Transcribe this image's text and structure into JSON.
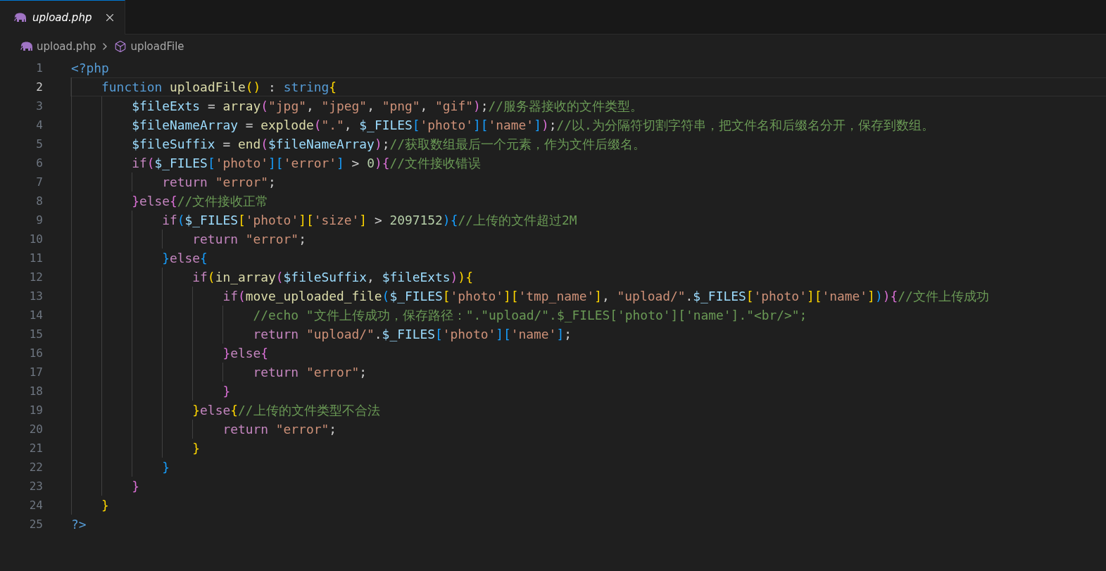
{
  "tabs": [
    {
      "label": "upload.php",
      "selected": true,
      "preview": true
    }
  ],
  "breadcrumb": {
    "file": "upload.php",
    "symbol": "uploadFile"
  },
  "lines": [
    {
      "number": "1",
      "selected": false,
      "tokens": [
        {
          "kind": "kw",
          "text": "<?php"
        }
      ],
      "children": [
        {
          "number": "2",
          "selected": true,
          "tokens": [
            {
              "kind": "kw",
              "text": "function "
            },
            {
              "kind": "fn",
              "text": "uploadFile"
            },
            {
              "kind": "b1",
              "text": "()"
            },
            {
              "kind": "op",
              "text": " : "
            },
            {
              "kind": "kw",
              "text": "string"
            },
            {
              "kind": "b1",
              "text": "{"
            }
          ],
          "children": [
            {
              "number": "3",
              "selected": false,
              "tokens": [
                {
                  "kind": "var",
                  "text": "$fileExts"
                },
                {
                  "kind": "op",
                  "text": " = "
                },
                {
                  "kind": "fn",
                  "text": "array"
                },
                {
                  "kind": "b2",
                  "text": "("
                },
                {
                  "kind": "str",
                  "text": "\"jpg\""
                },
                {
                  "kind": "op",
                  "text": ", "
                },
                {
                  "kind": "str",
                  "text": "\"jpeg\""
                },
                {
                  "kind": "op",
                  "text": ", "
                },
                {
                  "kind": "str",
                  "text": "\"png\""
                },
                {
                  "kind": "op",
                  "text": ", "
                },
                {
                  "kind": "str",
                  "text": "\"gif\""
                },
                {
                  "kind": "b2",
                  "text": ")"
                },
                {
                  "kind": "op",
                  "text": ";"
                },
                {
                  "kind": "cmt",
                  "text": "//服务器接收的文件类型。"
                }
              ]
            },
            {
              "number": "4",
              "selected": false,
              "tokens": [
                {
                  "kind": "var",
                  "text": "$fileNameArray"
                },
                {
                  "kind": "op",
                  "text": " = "
                },
                {
                  "kind": "fn",
                  "text": "explode"
                },
                {
                  "kind": "b2",
                  "text": "("
                },
                {
                  "kind": "str",
                  "text": "\".\""
                },
                {
                  "kind": "op",
                  "text": ", "
                },
                {
                  "kind": "var",
                  "text": "$_FILES"
                },
                {
                  "kind": "b3",
                  "text": "["
                },
                {
                  "kind": "str",
                  "text": "'photo'"
                },
                {
                  "kind": "b3",
                  "text": "]["
                },
                {
                  "kind": "str",
                  "text": "'name'"
                },
                {
                  "kind": "b3",
                  "text": "]"
                },
                {
                  "kind": "b2",
                  "text": ")"
                },
                {
                  "kind": "op",
                  "text": ";"
                },
                {
                  "kind": "cmt",
                  "text": "//以.为分隔符切割字符串，把文件名和后缀名分开，保存到数组。"
                }
              ]
            },
            {
              "number": "5",
              "selected": false,
              "tokens": [
                {
                  "kind": "var",
                  "text": "$fileSuffix"
                },
                {
                  "kind": "op",
                  "text": " = "
                },
                {
                  "kind": "fn",
                  "text": "end"
                },
                {
                  "kind": "b2",
                  "text": "("
                },
                {
                  "kind": "var",
                  "text": "$fileNameArray"
                },
                {
                  "kind": "b2",
                  "text": ")"
                },
                {
                  "kind": "op",
                  "text": ";"
                },
                {
                  "kind": "cmt",
                  "text": "//获取数组最后一个元素，作为文件后缀名。"
                }
              ]
            },
            {
              "number": "6",
              "selected": false,
              "tokens": [
                {
                  "kind": "ctrl",
                  "text": "if"
                },
                {
                  "kind": "b2",
                  "text": "("
                },
                {
                  "kind": "var",
                  "text": "$_FILES"
                },
                {
                  "kind": "b3",
                  "text": "["
                },
                {
                  "kind": "str",
                  "text": "'photo'"
                },
                {
                  "kind": "b3",
                  "text": "]["
                },
                {
                  "kind": "str",
                  "text": "'error'"
                },
                {
                  "kind": "b3",
                  "text": "]"
                },
                {
                  "kind": "op",
                  "text": " > "
                },
                {
                  "kind": "num",
                  "text": "0"
                },
                {
                  "kind": "b2",
                  "text": "){"
                },
                {
                  "kind": "cmt",
                  "text": "//文件接收错误"
                }
              ],
              "children": [
                {
                  "number": "7",
                  "selected": false,
                  "tokens": [
                    {
                      "kind": "ctrl",
                      "text": "return "
                    },
                    {
                      "kind": "str",
                      "text": "\"error\""
                    },
                    {
                      "kind": "op",
                      "text": ";"
                    }
                  ]
                }
              ]
            },
            {
              "number": "8",
              "selected": false,
              "tokens": [
                {
                  "kind": "b2",
                  "text": "}"
                },
                {
                  "kind": "ctrl",
                  "text": "else"
                },
                {
                  "kind": "b2",
                  "text": "{"
                },
                {
                  "kind": "cmt",
                  "text": "//文件接收正常"
                }
              ],
              "children": [
                {
                  "number": "9",
                  "selected": false,
                  "tokens": [
                    {
                      "kind": "ctrl",
                      "text": "if"
                    },
                    {
                      "kind": "b3",
                      "text": "("
                    },
                    {
                      "kind": "var",
                      "text": "$_FILES"
                    },
                    {
                      "kind": "b1",
                      "text": "["
                    },
                    {
                      "kind": "str",
                      "text": "'photo'"
                    },
                    {
                      "kind": "b1",
                      "text": "]["
                    },
                    {
                      "kind": "str",
                      "text": "'size'"
                    },
                    {
                      "kind": "b1",
                      "text": "]"
                    },
                    {
                      "kind": "op",
                      "text": " > "
                    },
                    {
                      "kind": "num",
                      "text": "2097152"
                    },
                    {
                      "kind": "b3",
                      "text": "){"
                    },
                    {
                      "kind": "cmt",
                      "text": "//上传的文件超过2M"
                    }
                  ],
                  "children": [
                    {
                      "number": "10",
                      "selected": false,
                      "tokens": [
                        {
                          "kind": "ctrl",
                          "text": "return "
                        },
                        {
                          "kind": "str",
                          "text": "\"error\""
                        },
                        {
                          "kind": "op",
                          "text": ";"
                        }
                      ]
                    }
                  ]
                },
                {
                  "number": "11",
                  "selected": false,
                  "tokens": [
                    {
                      "kind": "b3",
                      "text": "}"
                    },
                    {
                      "kind": "ctrl",
                      "text": "else"
                    },
                    {
                      "kind": "b3",
                      "text": "{"
                    }
                  ],
                  "children": [
                    {
                      "number": "12",
                      "selected": false,
                      "tokens": [
                        {
                          "kind": "ctrl",
                          "text": "if"
                        },
                        {
                          "kind": "b1",
                          "text": "("
                        },
                        {
                          "kind": "fn",
                          "text": "in_array"
                        },
                        {
                          "kind": "b2",
                          "text": "("
                        },
                        {
                          "kind": "var",
                          "text": "$fileSuffix"
                        },
                        {
                          "kind": "op",
                          "text": ", "
                        },
                        {
                          "kind": "var",
                          "text": "$fileExts"
                        },
                        {
                          "kind": "b2",
                          "text": ")"
                        },
                        {
                          "kind": "b1",
                          "text": "){"
                        }
                      ],
                      "children": [
                        {
                          "number": "13",
                          "selected": false,
                          "tokens": [
                            {
                              "kind": "ctrl",
                              "text": "if"
                            },
                            {
                              "kind": "b2",
                              "text": "("
                            },
                            {
                              "kind": "fn",
                              "text": "move_uploaded_file"
                            },
                            {
                              "kind": "b3",
                              "text": "("
                            },
                            {
                              "kind": "var",
                              "text": "$_FILES"
                            },
                            {
                              "kind": "b1",
                              "text": "["
                            },
                            {
                              "kind": "str",
                              "text": "'photo'"
                            },
                            {
                              "kind": "b1",
                              "text": "]["
                            },
                            {
                              "kind": "str",
                              "text": "'tmp_name'"
                            },
                            {
                              "kind": "b1",
                              "text": "]"
                            },
                            {
                              "kind": "op",
                              "text": ", "
                            },
                            {
                              "kind": "str",
                              "text": "\"upload/\""
                            },
                            {
                              "kind": "op",
                              "text": "."
                            },
                            {
                              "kind": "var",
                              "text": "$_FILES"
                            },
                            {
                              "kind": "b1",
                              "text": "["
                            },
                            {
                              "kind": "str",
                              "text": "'photo'"
                            },
                            {
                              "kind": "b1",
                              "text": "]["
                            },
                            {
                              "kind": "str",
                              "text": "'name'"
                            },
                            {
                              "kind": "b1",
                              "text": "]"
                            },
                            {
                              "kind": "b3",
                              "text": ")"
                            },
                            {
                              "kind": "b2",
                              "text": "){"
                            },
                            {
                              "kind": "cmt",
                              "text": "//文件上传成功"
                            }
                          ],
                          "children": [
                            {
                              "number": "14",
                              "selected": false,
                              "tokens": [
                                {
                                  "kind": "cmt",
                                  "text": "//echo \"文件上传成功，保存路径：\".\"upload/\".$_FILES['photo']['name'].\"<br/>\";"
                                }
                              ]
                            },
                            {
                              "number": "15",
                              "selected": false,
                              "tokens": [
                                {
                                  "kind": "ctrl",
                                  "text": "return "
                                },
                                {
                                  "kind": "str",
                                  "text": "\"upload/\""
                                },
                                {
                                  "kind": "op",
                                  "text": "."
                                },
                                {
                                  "kind": "var",
                                  "text": "$_FILES"
                                },
                                {
                                  "kind": "b3",
                                  "text": "["
                                },
                                {
                                  "kind": "str",
                                  "text": "'photo'"
                                },
                                {
                                  "kind": "b3",
                                  "text": "]["
                                },
                                {
                                  "kind": "str",
                                  "text": "'name'"
                                },
                                {
                                  "kind": "b3",
                                  "text": "]"
                                },
                                {
                                  "kind": "op",
                                  "text": ";"
                                }
                              ]
                            }
                          ]
                        },
                        {
                          "number": "16",
                          "selected": false,
                          "tokens": [
                            {
                              "kind": "b2",
                              "text": "}"
                            },
                            {
                              "kind": "ctrl",
                              "text": "else"
                            },
                            {
                              "kind": "b2",
                              "text": "{"
                            }
                          ],
                          "children": [
                            {
                              "number": "17",
                              "selected": false,
                              "tokens": [
                                {
                                  "kind": "ctrl",
                                  "text": "return "
                                },
                                {
                                  "kind": "str",
                                  "text": "\"error\""
                                },
                                {
                                  "kind": "op",
                                  "text": ";"
                                }
                              ]
                            }
                          ]
                        },
                        {
                          "number": "18",
                          "selected": false,
                          "tokens": [
                            {
                              "kind": "b2",
                              "text": "}"
                            }
                          ]
                        }
                      ]
                    },
                    {
                      "number": "19",
                      "selected": false,
                      "tokens": [
                        {
                          "kind": "b1",
                          "text": "}"
                        },
                        {
                          "kind": "ctrl",
                          "text": "else"
                        },
                        {
                          "kind": "b1",
                          "text": "{"
                        },
                        {
                          "kind": "cmt",
                          "text": "//上传的文件类型不合法"
                        }
                      ],
                      "children": [
                        {
                          "number": "20",
                          "selected": false,
                          "tokens": [
                            {
                              "kind": "ctrl",
                              "text": "return "
                            },
                            {
                              "kind": "str",
                              "text": "\"error\""
                            },
                            {
                              "kind": "op",
                              "text": ";"
                            }
                          ]
                        }
                      ]
                    },
                    {
                      "number": "21",
                      "selected": false,
                      "tokens": [
                        {
                          "kind": "b1",
                          "text": "}"
                        }
                      ]
                    }
                  ]
                },
                {
                  "number": "22",
                  "selected": false,
                  "tokens": [
                    {
                      "kind": "b3",
                      "text": "}"
                    }
                  ]
                }
              ]
            },
            {
              "number": "23",
              "selected": false,
              "tokens": [
                {
                  "kind": "b2",
                  "text": "}"
                }
              ]
            }
          ]
        },
        {
          "number": "24",
          "selected": false,
          "tokens": [
            {
              "kind": "b1",
              "text": "}"
            }
          ]
        }
      ]
    },
    {
      "number": "25",
      "selected": false,
      "tokens": [
        {
          "kind": "kw",
          "text": "?>"
        }
      ]
    }
  ]
}
